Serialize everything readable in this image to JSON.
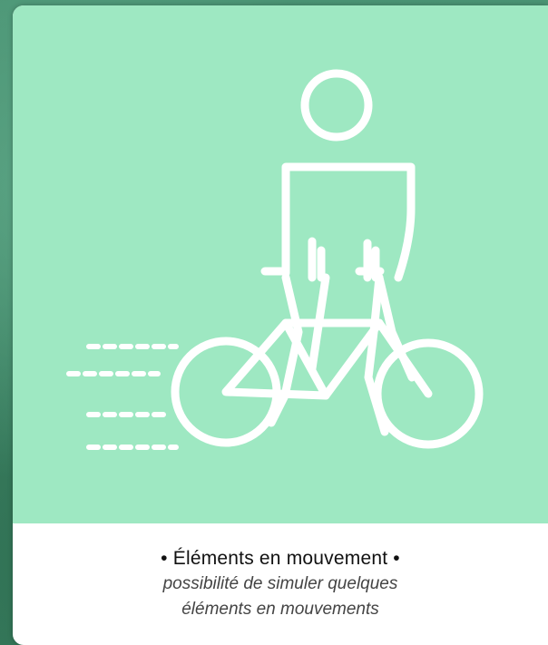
{
  "card": {
    "icon": "person-on-bicycle-moving-icon",
    "title": "• Éléments en mouvement •",
    "subtitle_line1": "possibilité de simuler quelques",
    "subtitle_line2": "éléments en mouvements"
  },
  "colors": {
    "illustration_background": "#9ee8c2",
    "illustration_stroke": "#ffffff",
    "caption_background": "#ffffff",
    "page_background": "#3f8868"
  }
}
